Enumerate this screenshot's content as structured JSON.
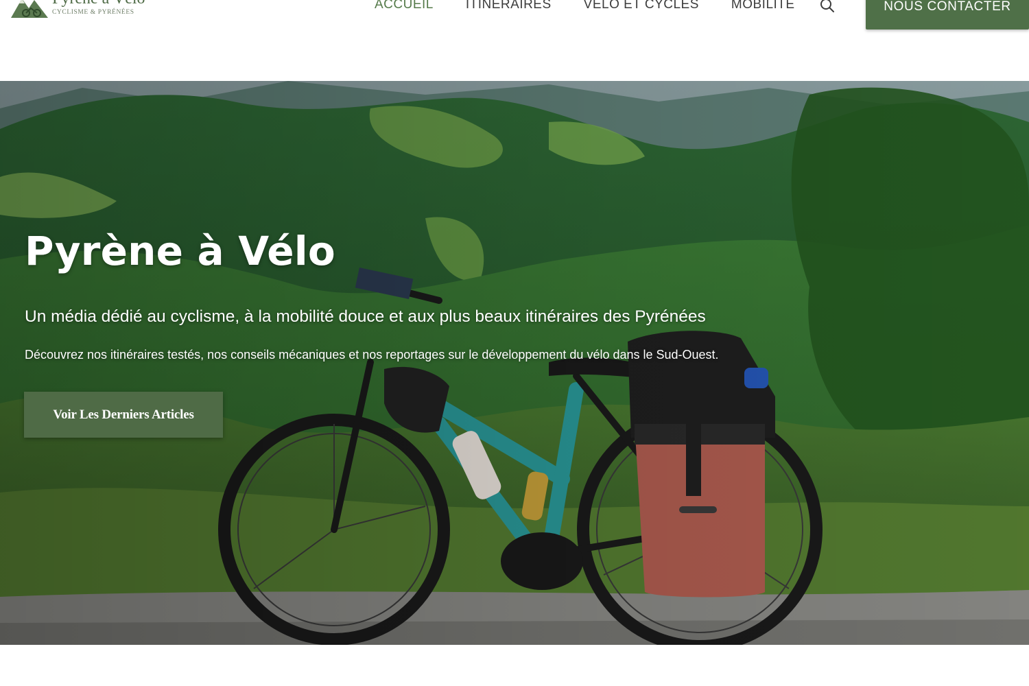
{
  "brand": {
    "title": "Pyrène à Vélo",
    "subtitle": "CYCLISME & PYRÉNÉES",
    "colors": {
      "primary": "#4f6b46",
      "button": "#4f7048",
      "nav_active": "#557a4a"
    }
  },
  "nav": {
    "items": [
      {
        "label": "ACCUEIL",
        "active": true
      },
      {
        "label": "ITINÉRAIRES",
        "active": false
      },
      {
        "label": "VÉLO ET CYCLES",
        "active": false
      },
      {
        "label": "MOBILITÉ",
        "active": false
      }
    ],
    "search_icon": "search-icon",
    "contact_label": "NOUS CONTACTER"
  },
  "hero": {
    "title": "Pyrène à Vélo",
    "subtitle": "Un média dédié au cyclisme, à la mobilité douce et aux plus beaux itinéraires des Pyrénées",
    "description": "Découvrez nos itinéraires testés, nos conseils mécaniques et nos reportages sur le développement du vélo dans le Sud-Ouest.",
    "cta_label": "Voir Les Derniers Articles",
    "image_subject": "loaded touring e-bike in front of green Pyrenees hills"
  }
}
